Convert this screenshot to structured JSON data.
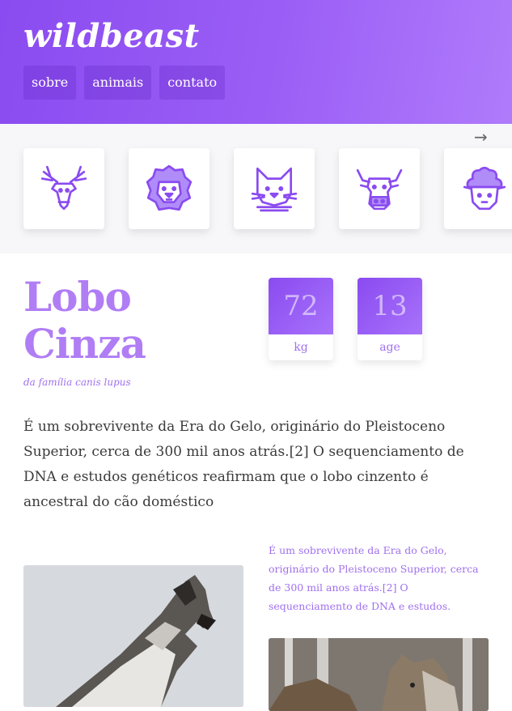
{
  "header": {
    "logo": "wildbeast",
    "nav": [
      {
        "label": "sobre"
      },
      {
        "label": "animais"
      },
      {
        "label": "contato"
      }
    ]
  },
  "animal_strip": {
    "next_arrow": "→",
    "icons": [
      "deer-icon",
      "lion-icon",
      "cat-icon",
      "bull-icon",
      "sheep-icon"
    ]
  },
  "animal": {
    "title_line1": "Lobo",
    "title_line2": "Cinza",
    "subtitle": "da família canis lupus",
    "stats": [
      {
        "value": "72",
        "unit": "kg"
      },
      {
        "value": "13",
        "unit": "age"
      }
    ],
    "description": "É um sobrevivente da Era do Gelo, originário do Pleistoceno Superior, cerca de 300 mil anos atrás.[2] O sequenciamento de DNA e estudos genéticos reafirmam que o lobo cinzento é ancestral do cão doméstico",
    "quote": "É um sobrevivente da Era do Gelo, originário do Pleistoceno Superior, cerca de 300 mil anos atrás.[2] O sequenciamento de DNA e estudos."
  },
  "colors": {
    "accent": "#9b5ff6",
    "accent_light": "#b07df5",
    "strip_bg": "#f7f7f9"
  }
}
